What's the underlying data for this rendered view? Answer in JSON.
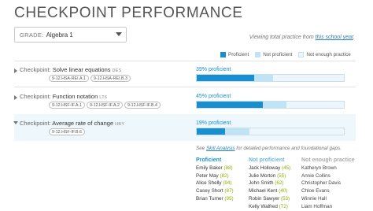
{
  "page": {
    "title": "CHECKPOINT PERFORMANCE"
  },
  "grade": {
    "label": "GRADE:",
    "value": "Algebra 1"
  },
  "view_note": {
    "prefix": "Viewing total practice from ",
    "link": "this school year",
    "suffix": "."
  },
  "legend": {
    "proficient": "Proficient",
    "not_proficient": "Not proficient",
    "not_enough": "Not enough practice"
  },
  "colors": {
    "proficient": "#1a8fd0",
    "not_proficient": "#bfe4f5",
    "not_enough": "#eef6fb"
  },
  "checkpoints": [
    {
      "prefix": "Checkpoint:",
      "name": "Solve linear equations",
      "code": "DES",
      "tags": [
        "9-12.HSA-REI.A.1",
        "9-12.HSA-REI.B.3"
      ],
      "bar_label": "39% proficient",
      "proficient_pct": 39,
      "not_proficient_pct": 13,
      "expanded": false
    },
    {
      "prefix": "Checkpoint:",
      "name": "Function notation",
      "code": "LT6",
      "tags": [
        "9-12.HSF-IF.A.1",
        "9-12.HSF-IF.A.2",
        "9-12.HSF-IF.B.4"
      ],
      "bar_label": "45% proficient",
      "proficient_pct": 45,
      "not_proficient_pct": 16,
      "expanded": false
    },
    {
      "prefix": "Checkpoint:",
      "name": "Average rate of change",
      "code": "HBY",
      "tags": [
        "9-12.HSF-IF.B.6"
      ],
      "bar_label": "19% proficient",
      "proficient_pct": 19,
      "not_proficient_pct": 17,
      "expanded": true
    }
  ],
  "see_note": {
    "prefix": "See ",
    "link": "Skill Analysis",
    "suffix": " for detailed performance and foundational gaps."
  },
  "students": {
    "proficient": {
      "header": "Proficient",
      "items": [
        {
          "name": "Emily Baker",
          "score": "(88)"
        },
        {
          "name": "Peter May",
          "score": "(82)"
        },
        {
          "name": "Alice Shelly",
          "score": "(94)"
        },
        {
          "name": "Casey Short",
          "score": "(87)"
        },
        {
          "name": "Brian Turner",
          "score": "(95)"
        }
      ]
    },
    "not_proficient": {
      "header": "Not proficient",
      "items": [
        {
          "name": "Jack Holloway",
          "score": "(45)"
        },
        {
          "name": "Julie Morton",
          "score": "(55)"
        },
        {
          "name": "John Smith",
          "score": "(62)"
        },
        {
          "name": "Michael Kent",
          "score": "(40)"
        },
        {
          "name": "Robin Sawyer",
          "score": "(53)"
        },
        {
          "name": "Kelly Walfred",
          "score": "(72)"
        }
      ]
    },
    "not_enough": {
      "header": "Not enough practice",
      "items": [
        "Katheryn Brown",
        "Annie Collins",
        "Christopher Davis",
        "Chloe Evans",
        "Winnie Hall",
        "Liam Hoffman"
      ]
    }
  }
}
